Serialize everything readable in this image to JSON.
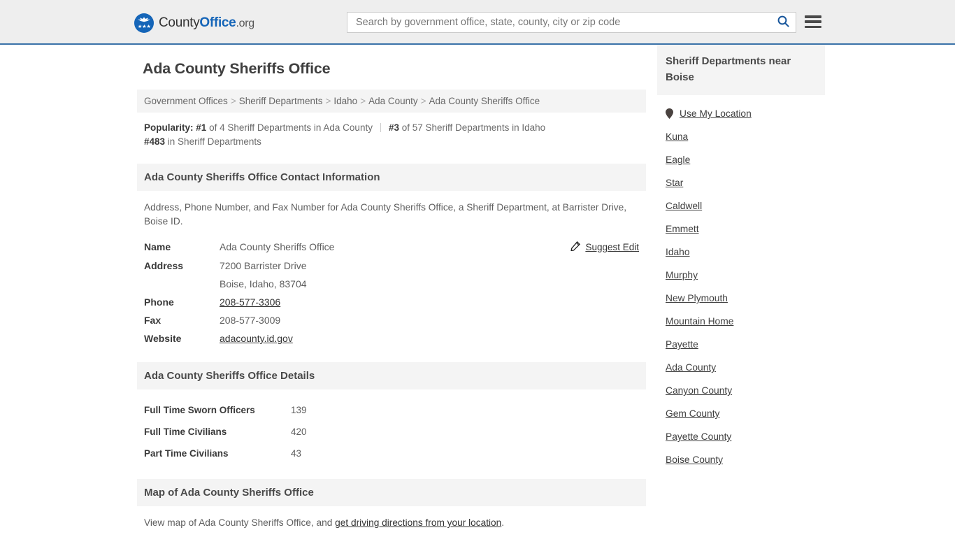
{
  "header": {
    "logo": {
      "part1": "County",
      "part2": "Office",
      "part3": ".org",
      "icon": "eagle-seal-icon",
      "stars": "★★★"
    },
    "search": {
      "placeholder": "Search by government office, state, county, city or zip code",
      "value": "",
      "icon": "search-icon"
    },
    "menu_icon": "hamburger-menu-icon",
    "accent_color": "#1565b8",
    "border_color": "#3a72a8",
    "background": "#eeeeee"
  },
  "page": {
    "title": "Ada County Sheriffs Office"
  },
  "breadcrumb": {
    "separator": ">",
    "items": [
      "Government Offices",
      "Sheriff Departments",
      "Idaho",
      "Ada County",
      "Ada County Sheriffs Office"
    ]
  },
  "popularity": {
    "label": "Popularity:",
    "entries": [
      {
        "rank": "#1",
        "text": "of 4 Sheriff Departments in Ada County"
      },
      {
        "rank": "#3",
        "text": "of 57 Sheriff Departments in Idaho"
      },
      {
        "rank": "#483",
        "text": "in Sheriff Departments"
      }
    ]
  },
  "contact": {
    "heading": "Ada County Sheriffs Office Contact Information",
    "description": "Address, Phone Number, and Fax Number for Ada County Sheriffs Office, a Sheriff Department, at Barrister Drive, Boise ID.",
    "suggest_edit": {
      "label": "Suggest Edit",
      "icon": "edit-pencil-icon"
    },
    "rows": [
      {
        "key": "Name",
        "value": "Ada County Sheriffs Office",
        "link": false
      },
      {
        "key": "Address",
        "value": "7200 Barrister Drive",
        "link": false
      },
      {
        "key": "",
        "value": "Boise, Idaho, 83704",
        "link": false
      },
      {
        "key": "Phone",
        "value": "208-577-3306",
        "link": true
      },
      {
        "key": "Fax",
        "value": "208-577-3009",
        "link": false
      },
      {
        "key": "Website",
        "value": "adacounty.id.gov",
        "link": true
      }
    ]
  },
  "details": {
    "heading": "Ada County Sheriffs Office Details",
    "rows": [
      {
        "key": "Full Time Sworn Officers",
        "value": "139"
      },
      {
        "key": "Full Time Civilians",
        "value": "420"
      },
      {
        "key": "Part Time Civilians",
        "value": "43"
      }
    ]
  },
  "map": {
    "heading": "Map of Ada County Sheriffs Office",
    "text_before": "View map of Ada County Sheriffs Office, and ",
    "link": "get driving directions from your location",
    "text_after": "."
  },
  "sidebar": {
    "heading": "Sheriff Departments near Boise",
    "location_item": {
      "label": "Use My Location",
      "icon": "map-pin-icon"
    },
    "items": [
      "Kuna",
      "Eagle",
      "Star",
      "Caldwell",
      "Emmett",
      "Idaho",
      "Murphy",
      "New Plymouth",
      "Mountain Home",
      "Payette",
      "Ada County",
      "Canyon County",
      "Gem County",
      "Payette County",
      "Boise County"
    ]
  }
}
